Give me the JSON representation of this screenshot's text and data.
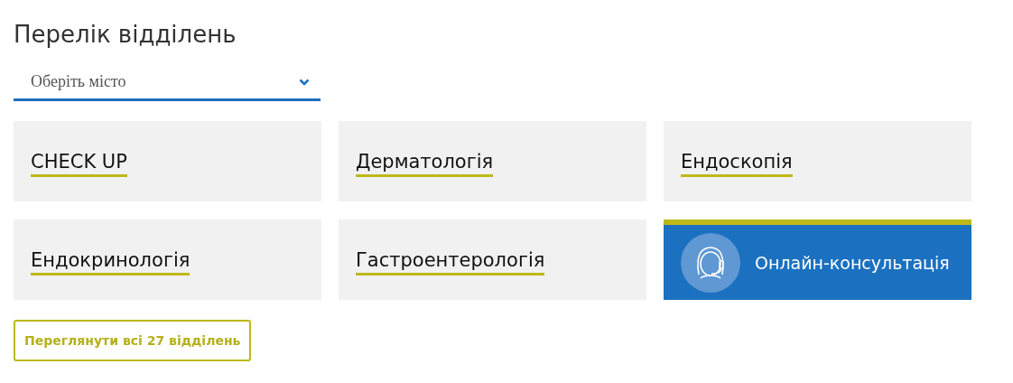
{
  "title": "Перелік відділень",
  "city_select": {
    "placeholder": "Оберіть місто"
  },
  "departments": [
    {
      "kind": "department",
      "label": "CHECK UP"
    },
    {
      "kind": "department",
      "label": "Дерматологія"
    },
    {
      "kind": "department",
      "label": "Ендоскопія"
    },
    {
      "kind": "department",
      "label": "Ендокринологія"
    },
    {
      "kind": "department",
      "label": "Гастроентерологія"
    },
    {
      "kind": "online",
      "label": "Онлайн-консультація"
    }
  ],
  "view_all_button": "Переглянути всі 27 відділень"
}
